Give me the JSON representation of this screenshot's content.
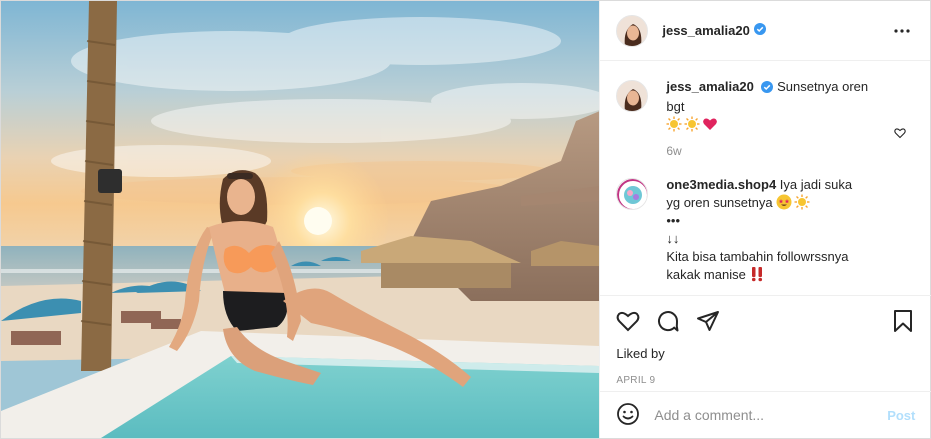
{
  "post": {
    "username": "jess_amalia20",
    "verified": true,
    "caption": {
      "username": "jess_amalia20",
      "text": "Sunsetnya oren bgt",
      "emojis": [
        "sun-emoji",
        "sun-emoji",
        "red-heart-emoji"
      ],
      "time": "6w"
    },
    "comments": [
      {
        "username": "one3media.shop4",
        "lines": [
          "Iya jadi suka",
          "yg oren sunsetnya",
          "•••",
          "↓↓",
          "Kita bisa tambahin followrssnya",
          "kakak manise"
        ],
        "line_2_emojis": [
          "star-struck-emoji",
          "sun-emoji"
        ],
        "line_6_emojis": [
          "double-exclamation-emoji"
        ]
      }
    ],
    "liked_by_label": "Liked by",
    "date": "APRIL 9",
    "add_comment_placeholder": "Add a comment...",
    "post_button": "Post"
  },
  "icons": {
    "more": "more-options-icon",
    "like": "heart-icon",
    "comment": "comment-bubble-icon",
    "share": "paper-plane-icon",
    "save": "bookmark-icon",
    "emoji": "smiley-icon",
    "comment_like": "small-heart-icon"
  },
  "colors": {
    "verified_blue": "#3897f0",
    "post_button": "#b2dffc",
    "secondary_text": "#8e8e8e"
  }
}
